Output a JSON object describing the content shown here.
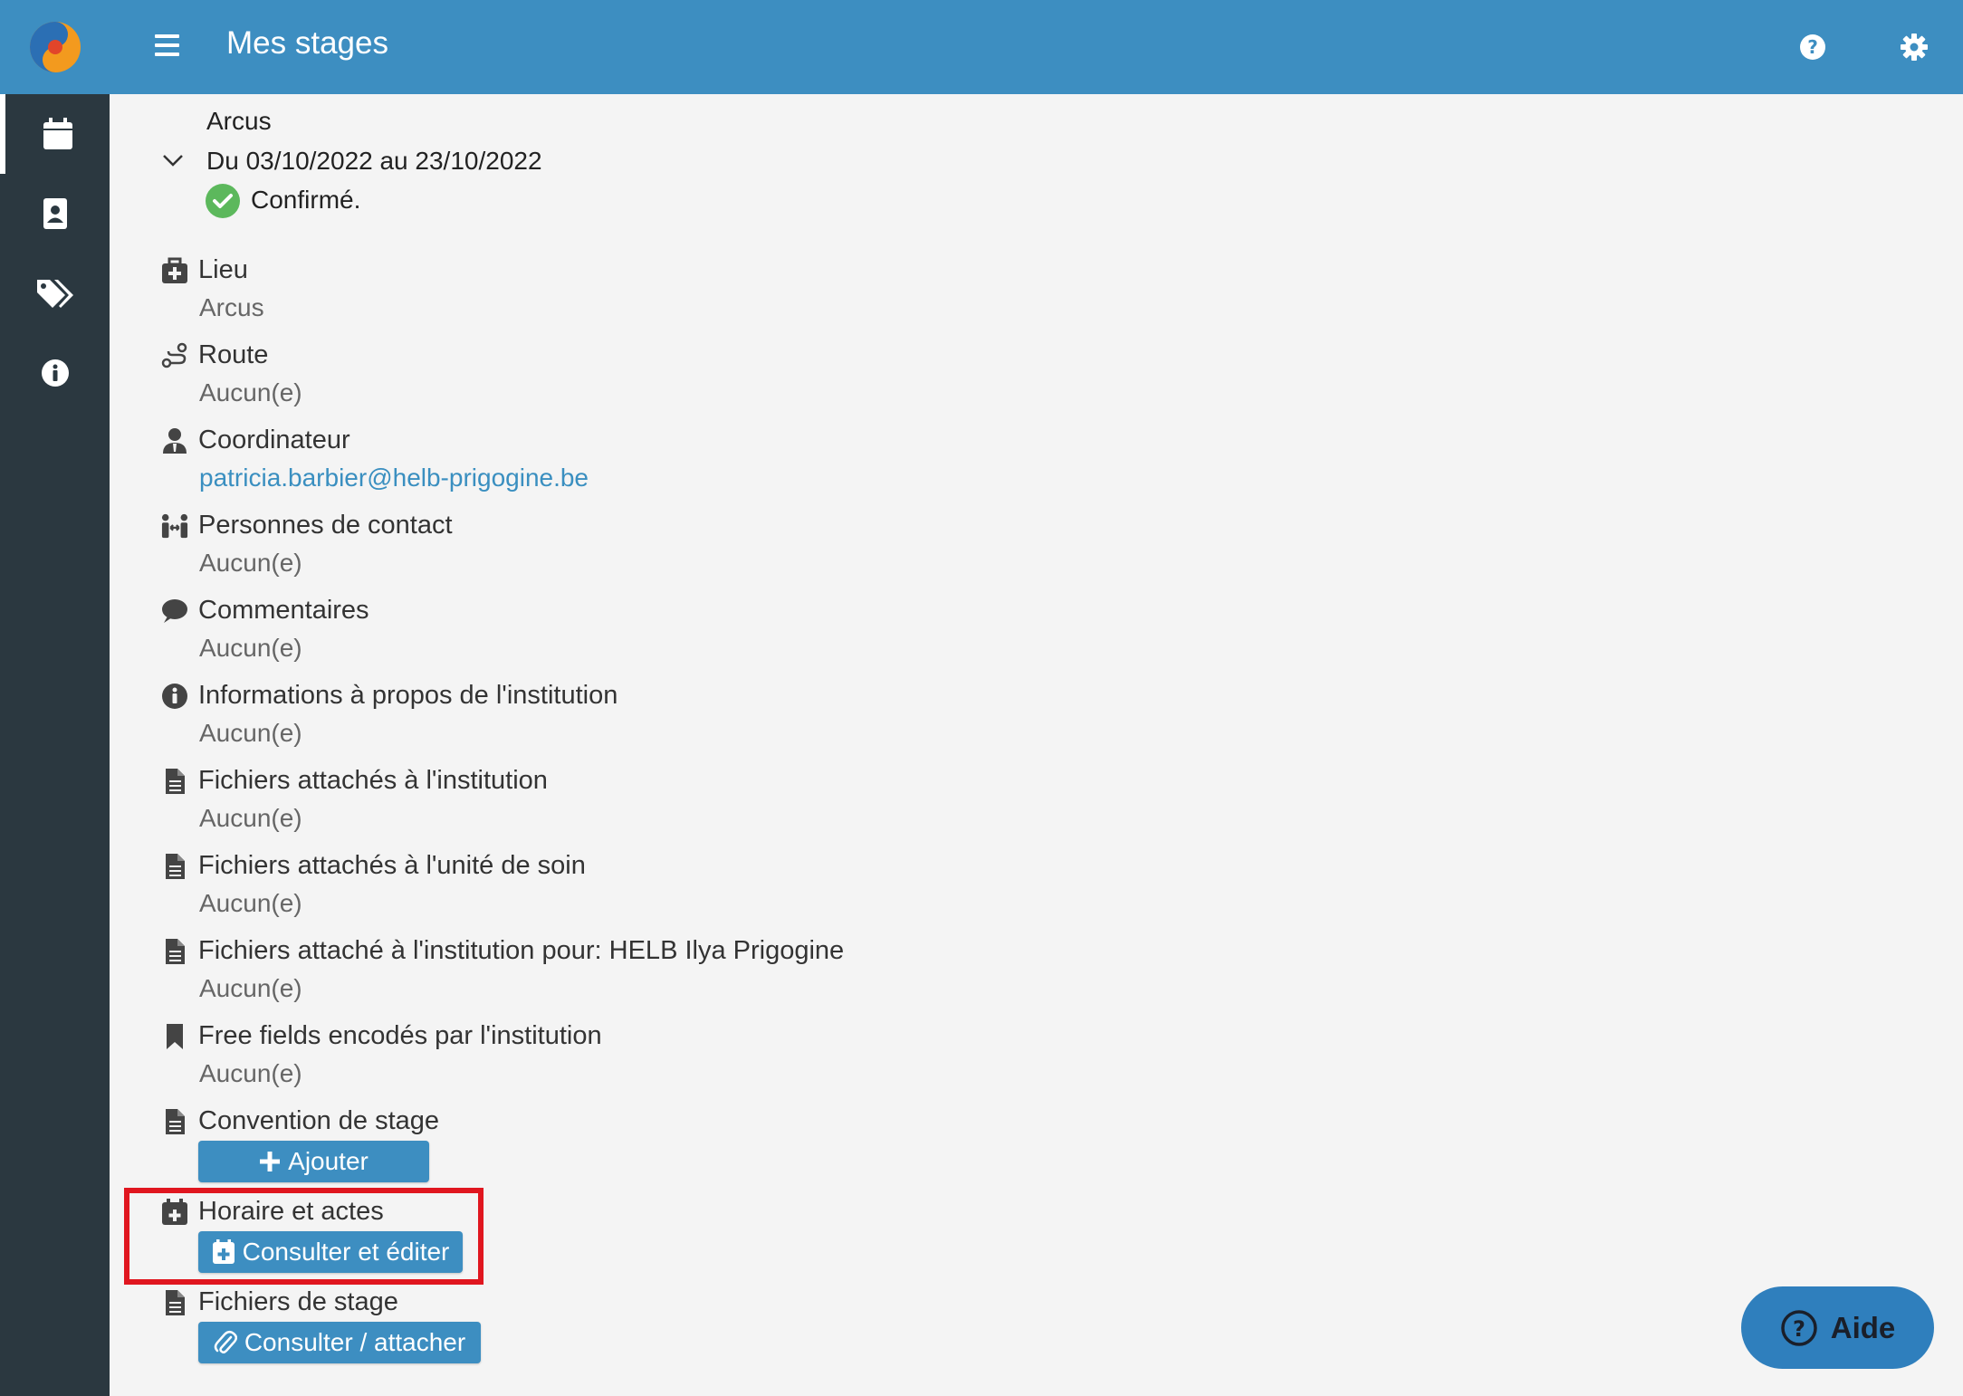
{
  "header": {
    "title": "Mes stages"
  },
  "stage": {
    "name": "Arcus",
    "dates": "Du 03/10/2022 au 23/10/2022",
    "status": "Confirmé."
  },
  "sections": {
    "lieu": {
      "title": "Lieu",
      "value": "Arcus"
    },
    "route": {
      "title": "Route",
      "value": "Aucun(e)"
    },
    "coordinateur": {
      "title": "Coordinateur",
      "value": "patricia.barbier@helb-prigogine.be"
    },
    "contacts": {
      "title": "Personnes de contact",
      "value": "Aucun(e)"
    },
    "commentaires": {
      "title": "Commentaires",
      "value": "Aucun(e)"
    },
    "infos": {
      "title": "Informations à propos de l'institution",
      "value": "Aucun(e)"
    },
    "fichiers_institution": {
      "title": "Fichiers attachés à l'institution",
      "value": "Aucun(e)"
    },
    "fichiers_unite": {
      "title": "Fichiers attachés à l'unité de soin",
      "value": "Aucun(e)"
    },
    "fichiers_helb": {
      "title": "Fichiers attaché à l'institution pour: HELB Ilya Prigogine",
      "value": "Aucun(e)"
    },
    "free_fields": {
      "title": "Free fields encodés par l'institution",
      "value": "Aucun(e)"
    },
    "convention": {
      "title": "Convention de stage",
      "button": "Ajouter"
    },
    "horaire": {
      "title": "Horaire et actes",
      "button": "Consulter et éditer"
    },
    "fichiers_stage": {
      "title": "Fichiers de stage",
      "button": "Consulter / attacher"
    }
  },
  "help_button": {
    "label": "Aide"
  },
  "colors": {
    "header": "#3d8ec1",
    "sidebar": "#2b3840",
    "highlight": "#e0161f",
    "link": "#3a8fc0",
    "status_ok": "#5cb85c"
  },
  "icons": [
    "calendar-icon",
    "id-card-icon",
    "tags-icon",
    "info-icon",
    "help-icon",
    "gear-icon"
  ]
}
